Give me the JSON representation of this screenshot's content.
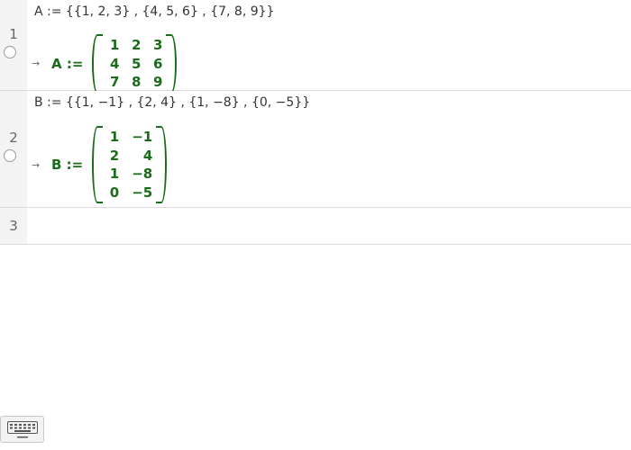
{
  "rows": [
    {
      "number": "1",
      "input": "A := {{1, 2, 3} , {4, 5, 6} , {7, 8, 9}}",
      "output_label": "A :=",
      "matrix": [
        [
          "1",
          "2",
          "3"
        ],
        [
          "4",
          "5",
          "6"
        ],
        [
          "7",
          "8",
          "9"
        ]
      ]
    },
    {
      "number": "2",
      "input": "B := {{1, −1} , {2, 4} , {1, −8} , {0, −5}}",
      "output_label": "B :=",
      "matrix": [
        [
          "1",
          "−1"
        ],
        [
          "2",
          "4"
        ],
        [
          "1",
          "−8"
        ],
        [
          "0",
          "−5"
        ]
      ]
    },
    {
      "number": "3",
      "input": ""
    }
  ],
  "output_arrow": "→",
  "colors": {
    "output_green": "#1a6b1a",
    "gutter": "#f3f3f3",
    "divider": "#dcdcdc"
  },
  "icons": {
    "keyboard": "keyboard-icon",
    "row_toggle": "radio-circle-icon"
  }
}
